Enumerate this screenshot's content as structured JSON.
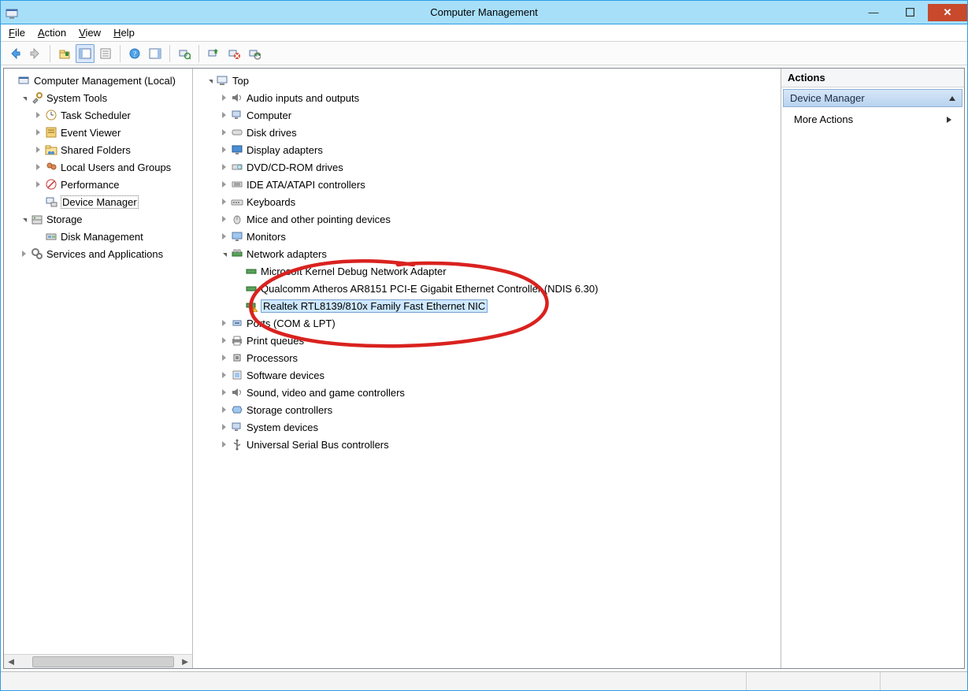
{
  "window": {
    "title": "Computer Management"
  },
  "menu": {
    "file": "File",
    "action": "Action",
    "view": "View",
    "help": "Help"
  },
  "left_tree": {
    "root": "Computer Management (Local)",
    "system_tools": "System Tools",
    "task_scheduler": "Task Scheduler",
    "event_viewer": "Event Viewer",
    "shared_folders": "Shared Folders",
    "local_users": "Local Users and Groups",
    "performance": "Performance",
    "device_manager": "Device Manager",
    "storage": "Storage",
    "disk_management": "Disk Management",
    "services_apps": "Services and Applications"
  },
  "center_tree": {
    "top": "Top",
    "audio": "Audio inputs and outputs",
    "computer": "Computer",
    "disk_drives": "Disk drives",
    "display": "Display adapters",
    "dvd": "DVD/CD-ROM drives",
    "ide": "IDE ATA/ATAPI controllers",
    "keyboards": "Keyboards",
    "mice": "Mice and other pointing devices",
    "monitors": "Monitors",
    "network": "Network adapters",
    "net_item_0": "Microsoft Kernel Debug Network Adapter",
    "net_item_1": "Qualcomm Atheros AR8151 PCI-E Gigabit Ethernet Controller (NDIS 6.30)",
    "net_item_2": "Realtek RTL8139/810x Family Fast Ethernet NIC",
    "ports": "Ports (COM & LPT)",
    "print": "Print queues",
    "processors": "Processors",
    "software": "Software devices",
    "sound": "Sound, video and game controllers",
    "storage_ctl": "Storage controllers",
    "system_devices": "System devices",
    "usb": "Universal Serial Bus controllers"
  },
  "actions": {
    "header": "Actions",
    "section": "Device Manager",
    "more": "More Actions"
  }
}
